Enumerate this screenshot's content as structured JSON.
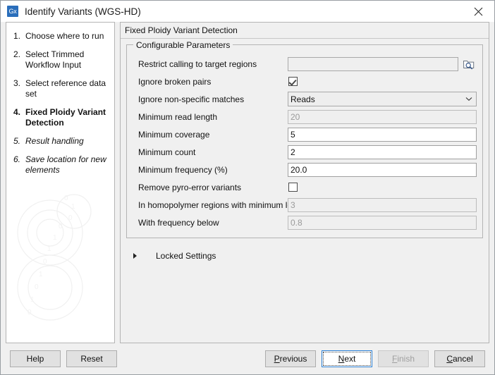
{
  "window": {
    "icon_label": "Gx",
    "title": "Identify Variants (WGS-HD)",
    "close_icon": "close-icon"
  },
  "sidebar": {
    "steps": [
      {
        "num": "1.",
        "label": "Choose where to run",
        "state": "done"
      },
      {
        "num": "2.",
        "label": "Select Trimmed Workflow Input",
        "state": "done"
      },
      {
        "num": "3.",
        "label": "Select reference data set",
        "state": "done"
      },
      {
        "num": "4.",
        "label": "Fixed Ploidy Variant Detection",
        "state": "current"
      },
      {
        "num": "5.",
        "label": "Result handling",
        "state": "future"
      },
      {
        "num": "6.",
        "label": "Save location for new elements",
        "state": "future"
      }
    ]
  },
  "panel": {
    "header": "Fixed Ploidy Variant Detection",
    "group_title": "Configurable Parameters",
    "fields": [
      {
        "label": "Restrict calling to target regions",
        "type": "text-browse",
        "value": "",
        "enabled": true,
        "browse_icon": "folder-search-icon"
      },
      {
        "label": "Ignore broken pairs",
        "type": "checkbox",
        "checked": true,
        "enabled": true
      },
      {
        "label": "Ignore non-specific matches",
        "type": "combo",
        "value": "Reads",
        "enabled": true,
        "chevron": "chevron-down-icon"
      },
      {
        "label": "Minimum read length",
        "type": "text",
        "value": "20",
        "enabled": false
      },
      {
        "label": "Minimum coverage",
        "type": "text",
        "value": "5",
        "enabled": true
      },
      {
        "label": "Minimum count",
        "type": "text",
        "value": "2",
        "enabled": true
      },
      {
        "label": "Minimum frequency (%)",
        "type": "text",
        "value": "20.0",
        "enabled": true
      },
      {
        "label": "Remove pyro-error variants",
        "type": "checkbox",
        "checked": false,
        "enabled": true
      },
      {
        "label": "In homopolymer regions with minimum length",
        "type": "text",
        "value": "3",
        "enabled": false
      },
      {
        "label": "With frequency below",
        "type": "text",
        "value": "0.8",
        "enabled": false
      }
    ],
    "locked_settings": {
      "label": "Locked Settings",
      "expander_icon": "triangle-right-icon",
      "expanded": false
    }
  },
  "footer": {
    "help": "Help",
    "reset": "Reset",
    "previous": {
      "pre": "",
      "mnemonic": "P",
      "post": "revious"
    },
    "next": {
      "pre": "",
      "mnemonic": "N",
      "post": "ext"
    },
    "finish": {
      "pre": "",
      "mnemonic": "F",
      "post": "inish",
      "disabled": true
    },
    "cancel": {
      "pre": "",
      "mnemonic": "C",
      "post": "ancel"
    }
  },
  "colors": {
    "accent": "#2a6ebb",
    "focus_border": "#2a7fd4",
    "dialog_bg": "#f0f0f0",
    "panel_bg": "#ffffff",
    "disabled_text": "#9a9a9a"
  }
}
